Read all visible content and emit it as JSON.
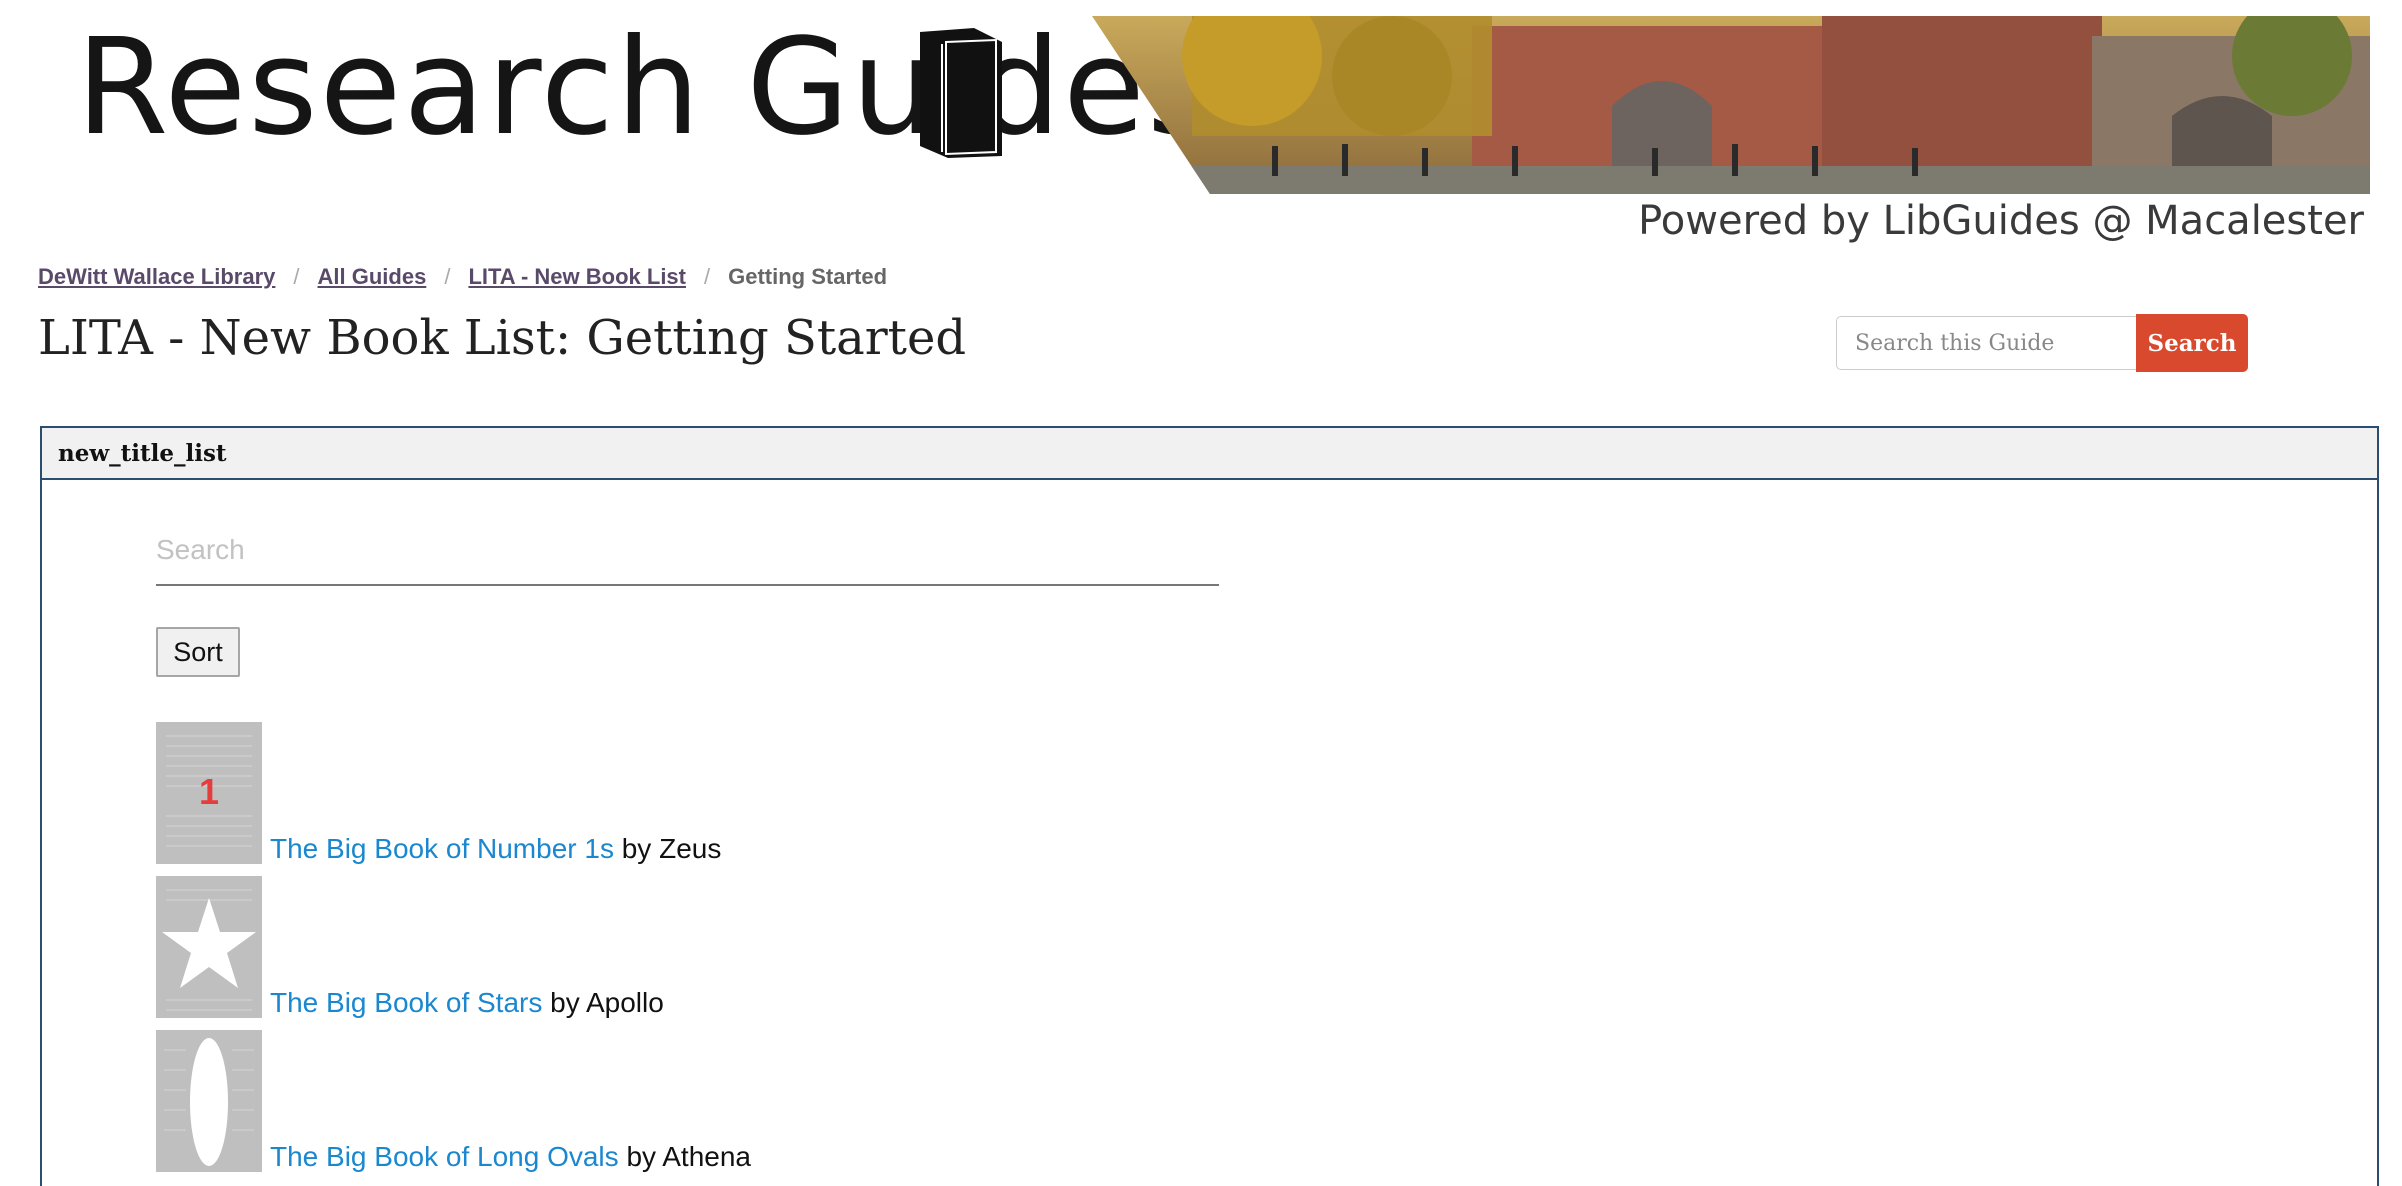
{
  "header": {
    "logo_text": "Research Guides",
    "powered_by": "Powered by LibGuides @ Macalester"
  },
  "breadcrumb": {
    "items": [
      "DeWitt Wallace Library",
      "All Guides",
      "LITA - New Book List"
    ],
    "current": "Getting Started",
    "separator": "/"
  },
  "page": {
    "title": "LITA - New Book List: Getting Started"
  },
  "guide_search": {
    "placeholder": "Search this Guide",
    "button_label": "Search"
  },
  "panel": {
    "heading": "new_title_list",
    "search_placeholder": "Search",
    "sort_label": "Sort"
  },
  "books": [
    {
      "title": "The Big Book of Number 1s",
      "by": "by",
      "author": "Zeus",
      "cover_icon": "number-1-icon",
      "cover_text": "1"
    },
    {
      "title": "The Big Book of Stars",
      "by": "by",
      "author": "Apollo",
      "cover_icon": "star-icon"
    },
    {
      "title": "The Big Book of Long Ovals",
      "by": "by",
      "author": "Athena",
      "cover_icon": "oval-icon"
    }
  ],
  "colors": {
    "accent_button": "#d9492d",
    "link": "#1a87cf",
    "panel_border": "#2b4d6f",
    "breadcrumb_link": "#5a4a6a"
  }
}
